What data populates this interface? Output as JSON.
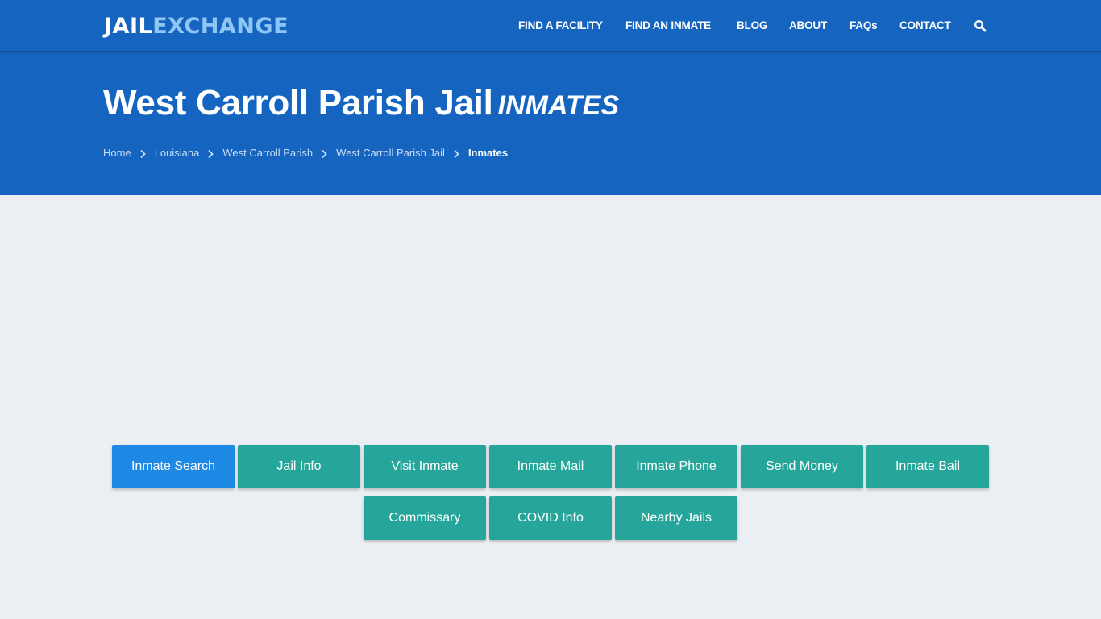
{
  "header": {
    "logo": {
      "part1": "JAIL",
      "part2": "EXCHANGE"
    },
    "nav": [
      {
        "label": "FIND A FACILITY"
      },
      {
        "label": "FIND AN INMATE"
      },
      {
        "label": "BLOG"
      },
      {
        "label": "ABOUT"
      },
      {
        "label": "FAQs"
      },
      {
        "label": "CONTACT"
      }
    ],
    "search_icon": "search-icon"
  },
  "hero": {
    "title": "West Carroll Parish Jail",
    "subtitle": "INMATES",
    "breadcrumb": [
      {
        "label": "Home"
      },
      {
        "label": "Louisiana"
      },
      {
        "label": "West Carroll Parish"
      },
      {
        "label": "West Carroll Parish Jail"
      },
      {
        "label": "Inmates"
      }
    ]
  },
  "buttons": [
    {
      "label": "Inmate Search",
      "active": true
    },
    {
      "label": "Jail Info"
    },
    {
      "label": "Visit Inmate"
    },
    {
      "label": "Inmate Mail"
    },
    {
      "label": "Inmate Phone"
    },
    {
      "label": "Send Money"
    },
    {
      "label": "Inmate Bail"
    },
    {
      "label": "Commissary"
    },
    {
      "label": "COVID Info"
    },
    {
      "label": "Nearby Jails"
    }
  ],
  "colors": {
    "brand_blue": "#1565c0",
    "logo_accent": "#8ec7f5",
    "button_teal": "#26a69a",
    "button_active_blue": "#1e88e5",
    "page_background": "#ebeef2"
  }
}
